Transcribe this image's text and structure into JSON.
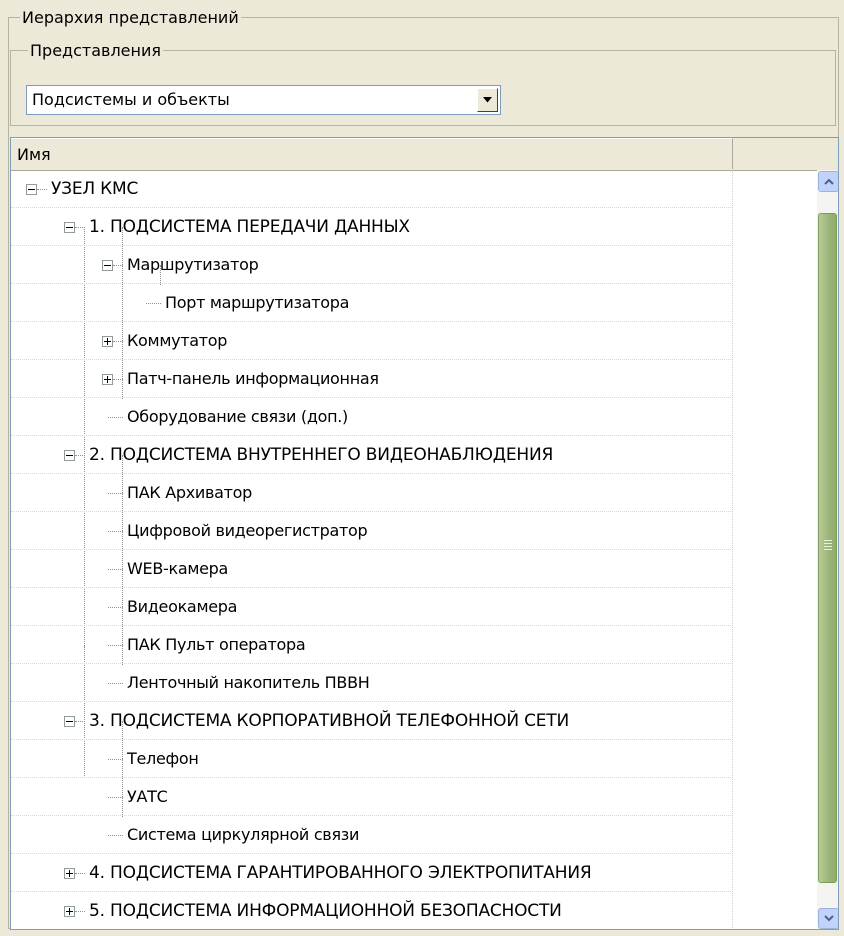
{
  "hierarchy_group": {
    "title": "Иерархия представлений"
  },
  "views_group": {
    "title": "Представления",
    "selected": "Подсистемы и объекты"
  },
  "tree": {
    "column_header": "Имя",
    "rows": [
      {
        "label": "УЗЕЛ КМС",
        "level": 0,
        "expander": "minus"
      },
      {
        "label": "1. ПОДСИСТЕМА ПЕРЕДАЧИ ДАННЫХ",
        "level": 1,
        "expander": "minus"
      },
      {
        "label": "Маршрутизатор",
        "level": 2,
        "expander": "minus"
      },
      {
        "label": "Порт маршрутизатора",
        "level": 3,
        "expander": "none"
      },
      {
        "label": "Коммутатор",
        "level": 2,
        "expander": "plus"
      },
      {
        "label": "Патч-панель информационная",
        "level": 2,
        "expander": "plus"
      },
      {
        "label": "Оборудование связи (доп.)",
        "level": 2,
        "expander": "none"
      },
      {
        "label": "2. ПОДСИСТЕМА ВНУТРЕННЕГО ВИДЕОНАБЛЮДЕНИЯ",
        "level": 1,
        "expander": "minus"
      },
      {
        "label": "ПАК Архиватор",
        "level": 2,
        "expander": "none"
      },
      {
        "label": "Цифровой видеорегистратор",
        "level": 2,
        "expander": "none"
      },
      {
        "label": "WEB-камера",
        "level": 2,
        "expander": "none"
      },
      {
        "label": "Видеокамера",
        "level": 2,
        "expander": "none"
      },
      {
        "label": "ПАК Пульт оператора",
        "level": 2,
        "expander": "none"
      },
      {
        "label": "Ленточный накопитель ПВВН",
        "level": 2,
        "expander": "none"
      },
      {
        "label": "3. ПОДСИСТЕМА КОРПОРАТИВНОЙ ТЕЛЕФОННОЙ СЕТИ",
        "level": 1,
        "expander": "minus"
      },
      {
        "label": "Телефон",
        "level": 2,
        "expander": "none"
      },
      {
        "label": "УАТС",
        "level": 2,
        "expander": "none"
      },
      {
        "label": "Система циркулярной связи",
        "level": 2,
        "expander": "none"
      },
      {
        "label": "4. ПОДСИСТЕМА ГАРАНТИРОВАННОГО ЭЛЕКТРОПИТАНИЯ",
        "level": 1,
        "expander": "plus"
      },
      {
        "label": "5. ПОДСИСТЕМА ИНФОРМАЦИОННОЙ БЕЗОПАСНОСТИ",
        "level": 1,
        "expander": "plus"
      }
    ]
  },
  "icons": {
    "dropdown": "chevron-down-icon",
    "scroll_up": "arrow-up-icon",
    "scroll_down": "arrow-down-icon",
    "expanded": "minus-box-icon",
    "collapsed": "plus-box-icon"
  },
  "colors": {
    "window_bg": "#ece9d8",
    "scroll_thumb": "#9fb87c",
    "scroll_button": "#c1d3fb"
  }
}
